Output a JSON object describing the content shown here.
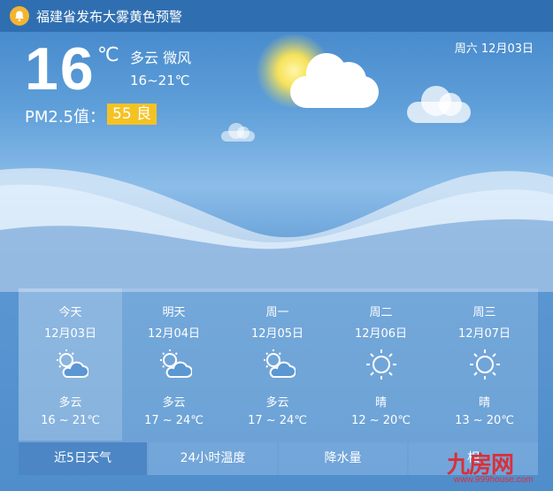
{
  "alert": {
    "text": "福建省发布大雾黄色预警",
    "icon": "bell-icon"
  },
  "current": {
    "temperature": "16",
    "unit": "℃",
    "condition": "多云 微风",
    "range": "16~21℃",
    "date": "周六 12月03日",
    "pm_label": "PM2.5值：",
    "pm_value": "55 良"
  },
  "forecast": [
    {
      "name": "今天",
      "date": "12月03日",
      "icon": "partly-cloudy-icon",
      "condition": "多云",
      "range": "16 ~ 21℃"
    },
    {
      "name": "明天",
      "date": "12月04日",
      "icon": "partly-cloudy-icon",
      "condition": "多云",
      "range": "17 ~ 24℃"
    },
    {
      "name": "周一",
      "date": "12月05日",
      "icon": "partly-cloudy-icon",
      "condition": "多云",
      "range": "17 ~ 24℃"
    },
    {
      "name": "周二",
      "date": "12月06日",
      "icon": "sun-icon",
      "condition": "晴",
      "range": "12 ~ 20℃"
    },
    {
      "name": "周三",
      "date": "12月07日",
      "icon": "sun-icon",
      "condition": "晴",
      "range": "13 ~ 20℃"
    }
  ],
  "tabs": [
    "近5日天气",
    "24小时温度",
    "降水量",
    "相"
  ],
  "watermark": {
    "text": "九房网",
    "url": "www.999house.com"
  },
  "colors": {
    "alert_bar": "#2f6fb1",
    "pm_badge": "#f5c224",
    "bell": "#f3b52f",
    "watermark": "#d9303a"
  }
}
